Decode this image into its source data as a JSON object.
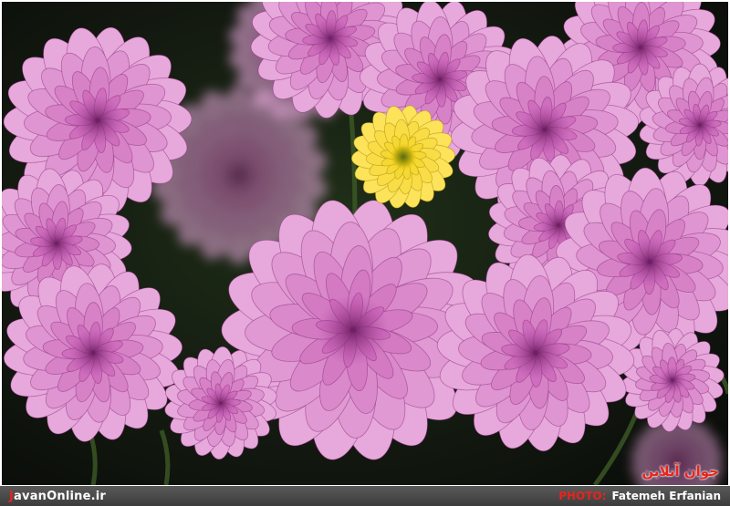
{
  "image": {
    "subject": "chrysanthemums",
    "colors": {
      "petal_pink": "#c65bb3",
      "petal_light": "#e7a8db",
      "petal_dark": "#8a2f7e",
      "yellow_flower": "#f3d21f",
      "background": "#12160f",
      "stem": "#3d5a26"
    },
    "watermark": {
      "text": "جوان آنلاین"
    }
  },
  "footer": {
    "site_prefix": "J",
    "site_rest": "avanOnline.ir",
    "photo_label": "PHOTO:",
    "photographer": "Fatemeh Erfanian",
    "accent": "#e8231c"
  }
}
